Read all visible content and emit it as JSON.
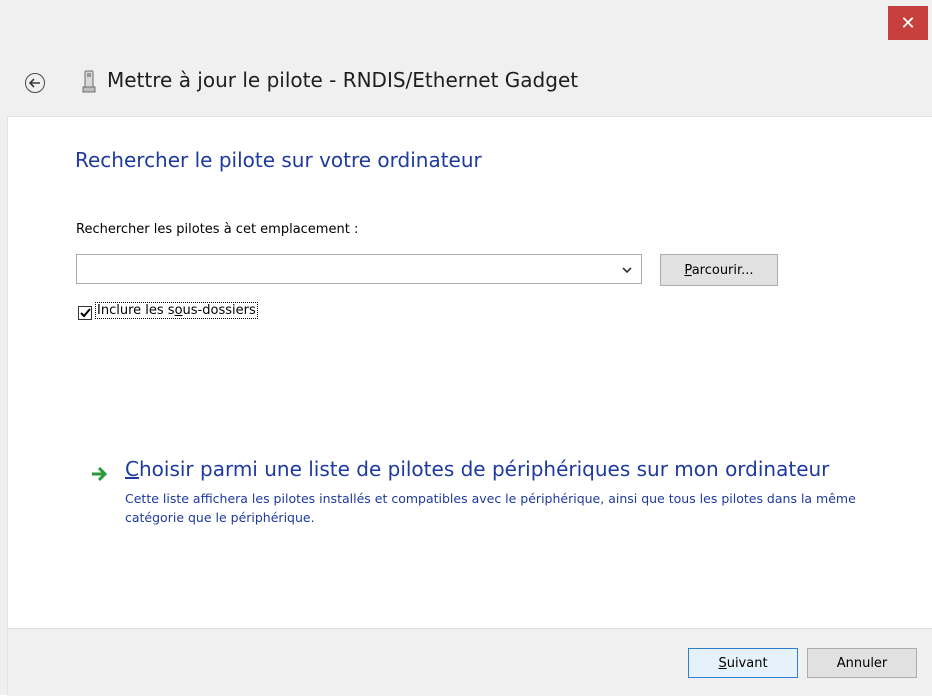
{
  "window": {
    "title": "Mettre à jour le pilote - RNDIS/Ethernet Gadget",
    "close_label": "✕"
  },
  "main": {
    "heading": "Rechercher le pilote sur votre ordinateur",
    "search_label": "Rechercher les pilotes à cet emplacement :",
    "path_value": "",
    "browse_pre": "",
    "browse_mnemonic": "P",
    "browse_post": "arcourir...",
    "include_pre": "Inclure les s",
    "include_mnemonic": "o",
    "include_post": "us-dossiers",
    "include_checked": true
  },
  "choose": {
    "link_mnemonic": "C",
    "link_post": "hoisir parmi une liste de pilotes de périphériques sur mon ordinateur",
    "description": "Cette liste affichera les pilotes installés et compatibles avec le périphérique, ainsi que tous les pilotes dans la même catégorie que le périphérique."
  },
  "footer": {
    "next_mnemonic": "S",
    "next_post": "uivant",
    "cancel_label": "Annuler"
  },
  "colors": {
    "accent_blue": "#1e3a9e",
    "close_red": "#c7403d",
    "arrow_green": "#2a9a3a"
  },
  "icons": [
    "back-arrow-icon",
    "device-icon",
    "chevron-down-icon",
    "checkmark-icon",
    "green-arrow-icon",
    "close-icon"
  ]
}
